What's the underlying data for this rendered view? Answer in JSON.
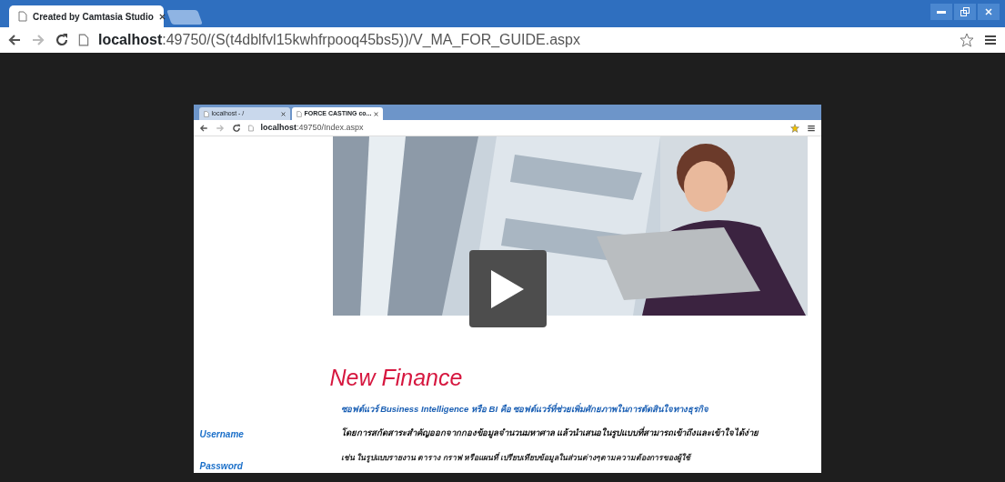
{
  "browser": {
    "tabs": [
      {
        "title": "Created by Camtasia Studio",
        "selected": true
      }
    ],
    "address": {
      "host": "localhost",
      "path": ":49750/(S(t4dblfvl15kwhfrpooq45bs5))/V_MA_FOR_GUIDE.aspx"
    }
  },
  "video": {
    "browser": {
      "tabs": [
        {
          "title": "localhost - /",
          "selected": false
        },
        {
          "title": "FORCE CASTING co...",
          "selected": true
        }
      ],
      "address": {
        "host": "localhost",
        "path": ":49750/Index.aspx"
      }
    },
    "sidebar": [
      {
        "label": "Username"
      },
      {
        "label": "Password"
      }
    ],
    "heading": "New Finance",
    "paragraphs": [
      {
        "text": "ซอฟต์แวร์ Business Intelligence หรือ BI คือ ซอฟต์แวร์ที่ช่วยเพิ่มศักยภาพในการตัดสินใจทางธุรกิจ",
        "kind": "link"
      },
      {
        "text": "โดยการสกัดสาระสำคัญออกจากกองข้อมูลจำนวนมหาศาล แล้วนำเสนอในรูปแบบที่สามารถเข้าถึงและเข้าใจได้ง่าย",
        "kind": "plain"
      },
      {
        "text": "เช่น ในรูปแบบรายงาน ตาราง กราฟ หรือแผนที่ เปรียบเทียบข้อมูลในส่วนต่างๆตามความต้องการของผู้ใช้",
        "kind": "small"
      }
    ]
  }
}
